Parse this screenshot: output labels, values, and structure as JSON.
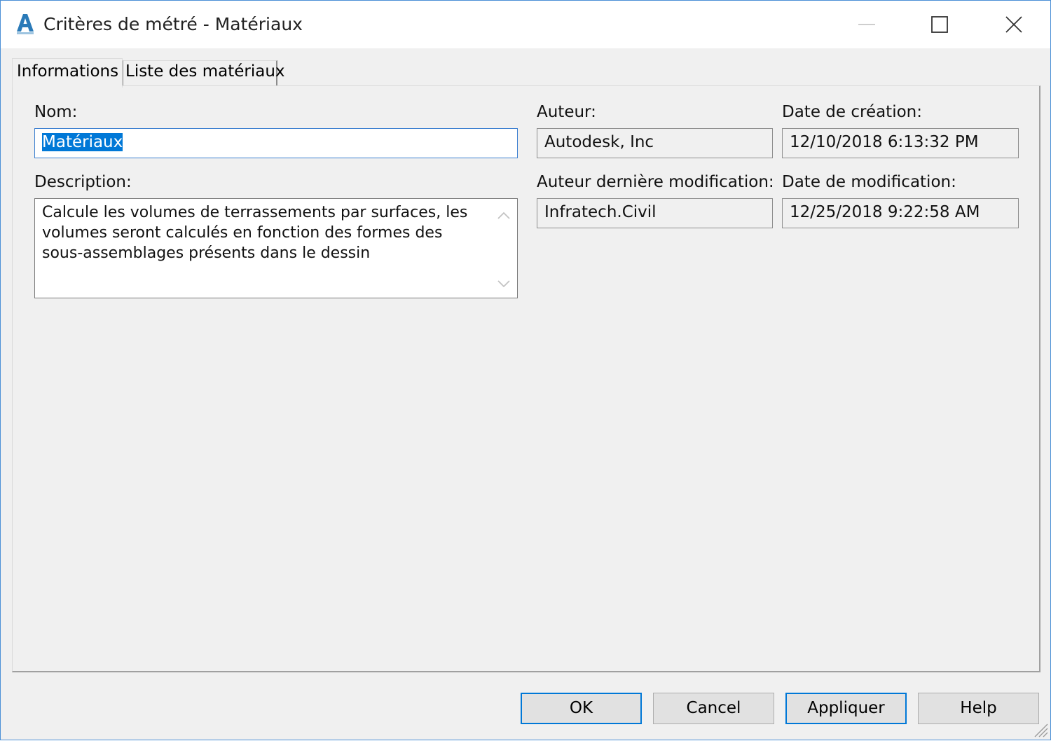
{
  "window": {
    "title": "Critères de métré - Matériaux",
    "accent_color": "#0078d7",
    "border_color": "#4a8fd6"
  },
  "tabs": [
    {
      "label": "Informations",
      "active": true
    },
    {
      "label": "Liste des matériaux",
      "active": false
    }
  ],
  "form": {
    "name_label": "Nom:",
    "name_value": "Matériaux",
    "description_label": "Description:",
    "description_value": "Calcule les volumes de terrassements par surfaces, les volumes seront calculés en fonction des formes des sous-assemblages présents dans le dessin",
    "author_label": "Auteur:",
    "author_value": "Autodesk, Inc",
    "created_label": "Date de création:",
    "created_value": "12/10/2018 6:13:32 PM",
    "modified_by_label": "Auteur dernière modification:",
    "modified_by_value": "Infratech.Civil",
    "modified_label": "Date de modification:",
    "modified_value": "12/25/2018 9:22:58 AM"
  },
  "buttons": {
    "ok": "OK",
    "cancel": "Cancel",
    "apply": "Appliquer",
    "help": "Help"
  },
  "icons": {
    "app": "autocad-civil-icon",
    "minimize": "minimize-icon",
    "maximize": "maximize-icon",
    "close": "close-icon"
  }
}
